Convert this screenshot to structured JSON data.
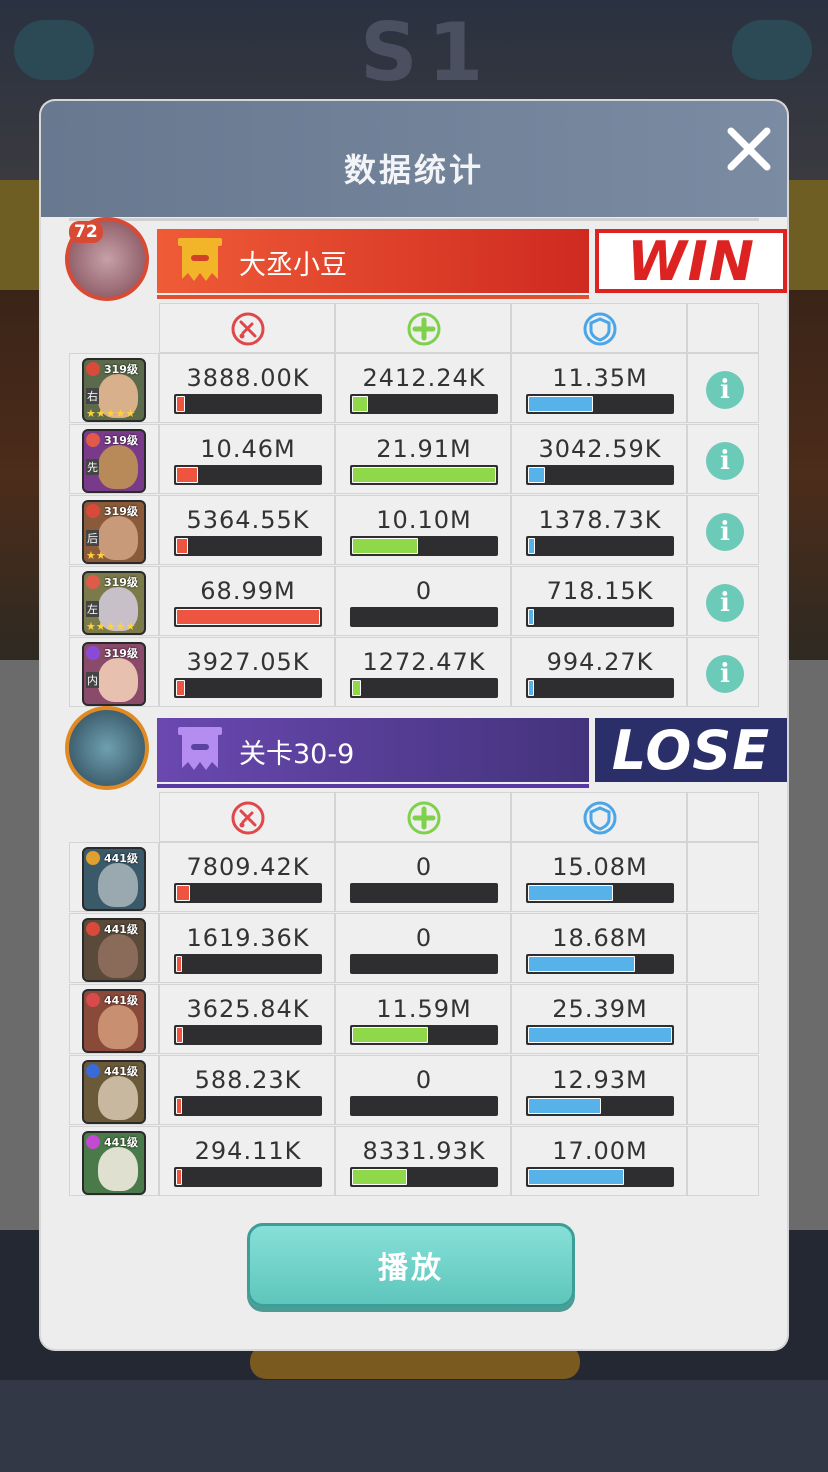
{
  "dialog": {
    "title": "数据统计"
  },
  "teams": [
    {
      "name": "大丞小豆",
      "result": "WIN",
      "leader_level": "72",
      "stat_icons": [
        "attack-icon",
        "heal-icon",
        "shield-icon"
      ],
      "heroes": [
        {
          "level": "319级",
          "pos": "右",
          "stars": "★★★★★",
          "damage": "3888.00K",
          "heal": "2412.24K",
          "taken": "11.35M",
          "damage_ratio": 0.06,
          "heal_ratio": 0.11,
          "taken_ratio": 0.45
        },
        {
          "level": "319级",
          "pos": "先",
          "stars": "",
          "damage": "10.46M",
          "heal": "21.91M",
          "taken": "3042.59K",
          "damage_ratio": 0.15,
          "heal_ratio": 1.0,
          "taken_ratio": 0.12
        },
        {
          "level": "319级",
          "pos": "后",
          "stars": "★★",
          "damage": "5364.55K",
          "heal": "10.10M",
          "taken": "1378.73K",
          "damage_ratio": 0.08,
          "heal_ratio": 0.46,
          "taken_ratio": 0.05
        },
        {
          "level": "319级",
          "pos": "左",
          "stars": "★★★★★",
          "damage": "68.99M",
          "heal": "0",
          "taken": "718.15K",
          "damage_ratio": 1.0,
          "heal_ratio": 0.0,
          "taken_ratio": 0.03
        },
        {
          "level": "319级",
          "pos": "内",
          "stars": "",
          "damage": "3927.05K",
          "heal": "1272.47K",
          "taken": "994.27K",
          "damage_ratio": 0.06,
          "heal_ratio": 0.06,
          "taken_ratio": 0.04
        }
      ]
    },
    {
      "name": "关卡30-9",
      "result": "LOSE",
      "stat_icons": [
        "attack-icon",
        "heal-icon",
        "shield-icon"
      ],
      "heroes": [
        {
          "level": "441级",
          "damage": "7809.42K",
          "heal": "0",
          "taken": "15.08M",
          "damage_ratio": 0.1,
          "heal_ratio": 0.0,
          "taken_ratio": 0.59
        },
        {
          "level": "441级",
          "damage": "1619.36K",
          "heal": "0",
          "taken": "18.68M",
          "damage_ratio": 0.02,
          "heal_ratio": 0.0,
          "taken_ratio": 0.74
        },
        {
          "level": "441级",
          "damage": "3625.84K",
          "heal": "11.59M",
          "taken": "25.39M",
          "damage_ratio": 0.05,
          "heal_ratio": 0.53,
          "taken_ratio": 1.0
        },
        {
          "level": "441级",
          "damage": "588.23K",
          "heal": "0",
          "taken": "12.93M",
          "damage_ratio": 0.01,
          "heal_ratio": 0.0,
          "taken_ratio": 0.51
        },
        {
          "level": "441级",
          "damage": "294.11K",
          "heal": "8331.93K",
          "taken": "17.00M",
          "damage_ratio": 0.01,
          "heal_ratio": 0.38,
          "taken_ratio": 0.67
        }
      ]
    }
  ],
  "play_button": "播放",
  "colors": {
    "damage": "#ee5540",
    "heal": "#8fd84a",
    "taken": "#58b2ea",
    "win": "#dd2222",
    "lose_bg": "#2a2f6a",
    "info": "#6ccab8"
  }
}
